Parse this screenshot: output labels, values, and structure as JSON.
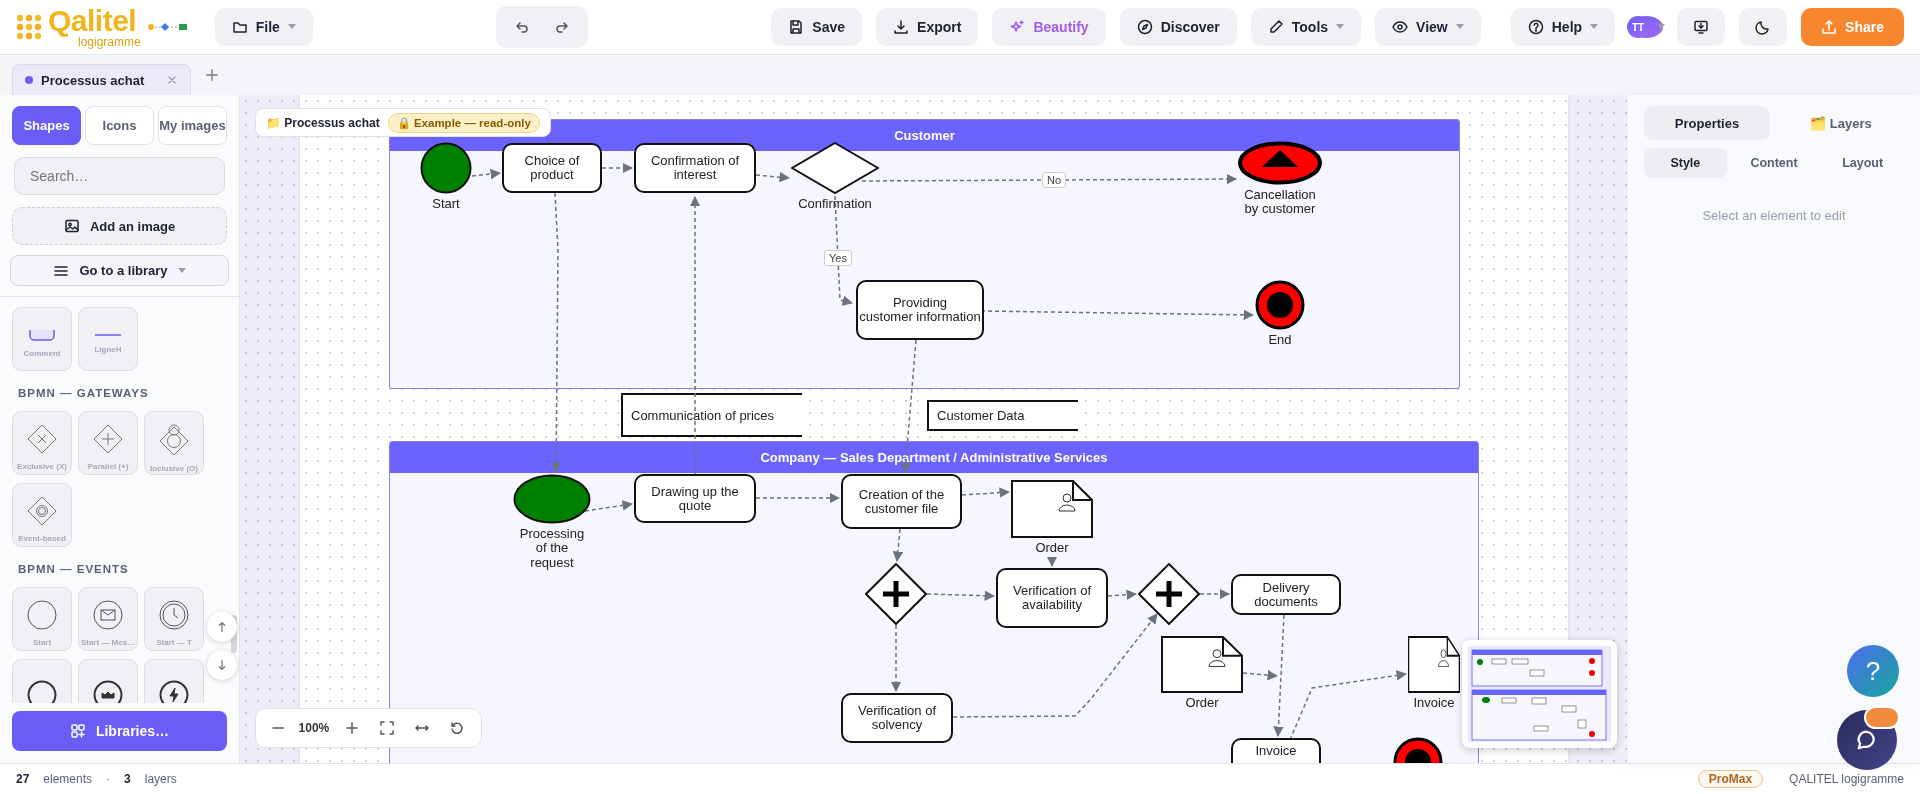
{
  "app": {
    "logo_name": "Qalitel",
    "logo_sub": "logigramme"
  },
  "toolbar": {
    "file": {
      "kind": "file",
      "label": "File",
      "menu": true
    },
    "history": [
      {
        "kind": "undo"
      },
      {
        "kind": "redo"
      }
    ],
    "actions": [
      {
        "kind": "save",
        "label": "Save",
        "menu": false
      },
      {
        "kind": "export",
        "label": "Export",
        "menu": false
      },
      {
        "kind": "beautify",
        "label": "Beautify",
        "menu": false
      },
      {
        "kind": "discover",
        "label": "Discover",
        "menu": false
      },
      {
        "kind": "tools",
        "label": "Tools",
        "menu": true
      },
      {
        "kind": "view",
        "label": "View",
        "menu": true
      }
    ],
    "account": [
      {
        "kind": "help",
        "label": "Help",
        "menu": true
      },
      {
        "kind": "avatar",
        "label": "TT",
        "menu": true
      },
      {
        "kind": "present"
      },
      {
        "kind": "theme"
      },
      {
        "kind": "share",
        "label": "Share",
        "menu": false
      }
    ]
  },
  "tabs": [
    {
      "label": "Processus achat",
      "selected": true
    }
  ],
  "sidebar": {
    "tabs": [
      {
        "label": "Shapes",
        "selected": true
      },
      {
        "label": "Icons",
        "selected": false
      },
      {
        "label": "My images",
        "selected": false
      }
    ],
    "search": {
      "placeholder": "Search…"
    },
    "add_image": "Add an image",
    "library": {
      "label": "Go to a library",
      "menu": true
    },
    "sections": [
      {
        "items": [
          {
            "kind": "comment",
            "label": "Comment"
          },
          {
            "kind": "line",
            "label": "LigneH"
          }
        ]
      },
      {
        "title": "BPMN — GATEWAYS",
        "items": [
          {
            "kind": "exclusive",
            "label": "Exclusive (X)"
          },
          {
            "kind": "parallel",
            "label": "Parallel (+)"
          },
          {
            "kind": "inclusive",
            "label": "Inclusive (O)"
          },
          {
            "kind": "event",
            "label": "Event-based"
          }
        ]
      },
      {
        "title": "BPMN — EVENTS",
        "items": [
          {
            "kind": "start",
            "label": "Start"
          },
          {
            "kind": "message",
            "label": "Start — Mes…"
          },
          {
            "kind": "timer",
            "label": "Start — T"
          },
          {
            "kind": "bold"
          },
          {
            "kind": "crown"
          },
          {
            "kind": "lightning"
          }
        ]
      }
    ],
    "libraries_button": "Libraries…"
  },
  "canvas": {
    "title": "📁 Processus achat",
    "badge": "🔒 Example — read-only",
    "zoom": "100%",
    "lanes": [
      {
        "title": "Customer",
        "nodes": [
          {
            "kind": "start",
            "label": "Start"
          },
          {
            "kind": "task",
            "label": "Choice of\nproduct"
          },
          {
            "kind": "task",
            "label": "Confirmation of\ninterest"
          },
          {
            "kind": "gateway",
            "label": "Confirmation"
          },
          {
            "kind": "cancel",
            "label": "Cancellation\nby customer"
          },
          {
            "kind": "task",
            "label": "Providing\ncustomer information"
          },
          {
            "kind": "end",
            "label": "End"
          }
        ]
      },
      {
        "title": "Company — Sales Department / Administrative Services",
        "nodes": [
          {
            "kind": "oval",
            "label": "Processing\nof the\nrequest"
          },
          {
            "kind": "task",
            "label": "Drawing up the\nquote"
          },
          {
            "kind": "task",
            "label": "Creation of the\ncustomer file"
          },
          {
            "kind": "document",
            "label": "Order"
          },
          {
            "kind": "parallel"
          },
          {
            "kind": "task",
            "label": "Verification of\navailability"
          },
          {
            "kind": "parallel"
          },
          {
            "kind": "task",
            "label": "Delivery\ndocuments"
          },
          {
            "kind": "document",
            "label": "Order"
          },
          {
            "kind": "document",
            "label": "Invoice"
          },
          {
            "kind": "task",
            "label": "Verification of\nsolvency"
          },
          {
            "kind": "task",
            "label": "Invoice"
          },
          {
            "kind": "end"
          }
        ]
      }
    ],
    "annotations": [
      "Communication of prices",
      "Customer Data"
    ],
    "edge_labels": [
      "No",
      "Yes"
    ]
  },
  "properties": {
    "tabs": [
      {
        "label": "Properties",
        "selected": true
      },
      {
        "label": "🗂️ Layers",
        "selected": false
      }
    ],
    "subtabs": [
      {
        "label": "Style",
        "selected": true
      },
      {
        "label": "Content",
        "selected": false
      },
      {
        "label": "Layout",
        "selected": false
      }
    ],
    "empty": "Select an element to edit"
  },
  "help_button": "?",
  "status": {
    "elements_count": "27",
    "elements_label": "elements",
    "separator": "·",
    "layers_count": "3",
    "layers_label": "layers",
    "plan": "ProMax",
    "brand": "QALITEL logigramme"
  }
}
